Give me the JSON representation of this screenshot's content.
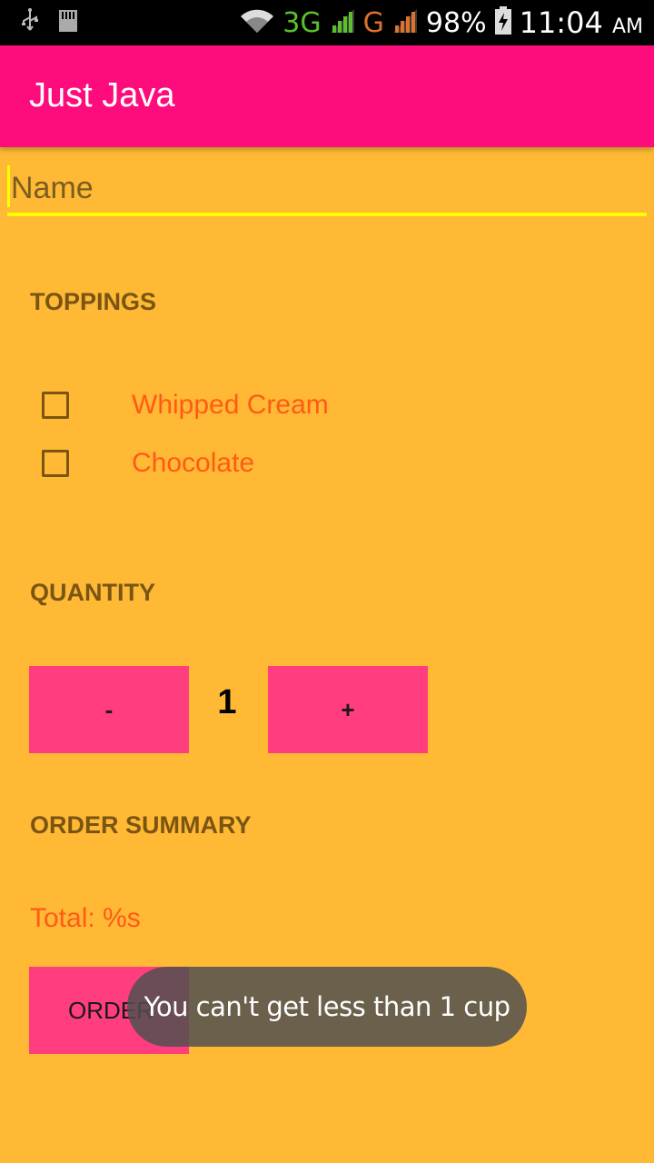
{
  "status_bar": {
    "network_3g": "3G",
    "network_g": "G",
    "battery": "98%",
    "time": "11:04",
    "ampm": "AM",
    "icons": [
      "usb-icon",
      "sd-card-icon",
      "wifi-icon",
      "signal-icon",
      "battery-icon"
    ]
  },
  "app_bar": {
    "title": "Just Java",
    "color": "#FF0C7C"
  },
  "name_field": {
    "placeholder": "Name",
    "value": ""
  },
  "toppings": {
    "header": "TOPPINGS",
    "items": [
      {
        "label": "Whipped Cream",
        "checked": false
      },
      {
        "label": "Chocolate",
        "checked": false
      }
    ]
  },
  "quantity": {
    "header": "QUANTITY",
    "decrement_label": "-",
    "value": "1",
    "increment_label": "+"
  },
  "order_summary": {
    "header": "ORDER SUMMARY",
    "total_text": "Total: %s",
    "order_button_label": "ORDER"
  },
  "toast": {
    "message": "You can't get less than 1 cup"
  },
  "colors": {
    "background": "#FFB935",
    "button": "#FF3D7F",
    "accent_text": "#FF5A16",
    "header_text": "#7A5512",
    "input_underline": "#FFFF00"
  }
}
